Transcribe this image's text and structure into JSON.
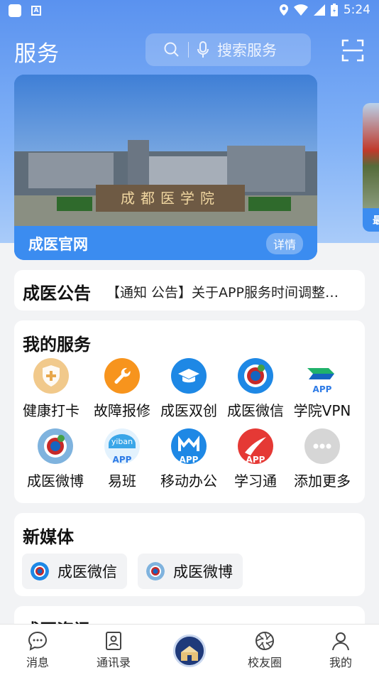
{
  "status_bar": {
    "time": "5:24",
    "icons": [
      "app-square-icon",
      "a-notification-icon",
      "location-icon",
      "wifi-icon",
      "signal-icon",
      "battery-icon"
    ]
  },
  "header": {
    "title": "服务",
    "search_placeholder": "搜索服务",
    "icons": [
      "search-icon",
      "mic-icon",
      "scan-icon"
    ]
  },
  "banner": {
    "title": "成医官网",
    "detail_label": "详情",
    "sign_text": "成都医学院",
    "next_peek_text": "最"
  },
  "notice": {
    "label": "成医公告",
    "text": "【通知 公告】关于APP服务时间调整的通知"
  },
  "services": {
    "title": "我的服务",
    "items": [
      {
        "label": "健康打卡",
        "icon": "health-shield-icon",
        "color": "#f1c98b"
      },
      {
        "label": "故障报修",
        "icon": "wrench-icon",
        "color": "#f7941d"
      },
      {
        "label": "成医双创",
        "icon": "graduation-cap-icon",
        "color": "#1e88e5"
      },
      {
        "label": "成医微信",
        "icon": "school-emblem-icon",
        "color": "#1e88e5"
      },
      {
        "label": "学院VPN",
        "icon": "vpn-icon",
        "color": "#20b26b",
        "tag": "APP"
      },
      {
        "label": "成医微博",
        "icon": "school-emblem-icon",
        "color": "#7fb3de"
      },
      {
        "label": "易班",
        "icon": "yiban-icon",
        "color": "#3aa6e8",
        "tag": "APP"
      },
      {
        "label": "移动办公",
        "icon": "office-m-icon",
        "color": "#1e88e5",
        "tag": "APP"
      },
      {
        "label": "学习通",
        "icon": "xuexitong-icon",
        "color": "#e53935",
        "tag": "APP"
      },
      {
        "label": "添加更多",
        "icon": "more-dots-icon",
        "color": "#d6d6d6"
      }
    ]
  },
  "media": {
    "title": "新媒体",
    "items": [
      {
        "label": "成医微信",
        "icon": "school-emblem-icon",
        "color": "#1e88e5"
      },
      {
        "label": "成医微博",
        "icon": "school-emblem-icon",
        "color": "#7fb3de"
      }
    ]
  },
  "next_section": {
    "title": "成医资讯"
  },
  "bottom_nav": {
    "items": [
      {
        "label": "消息",
        "icon": "chat-bubble-icon"
      },
      {
        "label": "通讯录",
        "icon": "contacts-icon"
      },
      {
        "label": "",
        "icon": "school-logo-icon"
      },
      {
        "label": "校友圈",
        "icon": "aperture-icon"
      },
      {
        "label": "我的",
        "icon": "person-icon"
      }
    ]
  }
}
